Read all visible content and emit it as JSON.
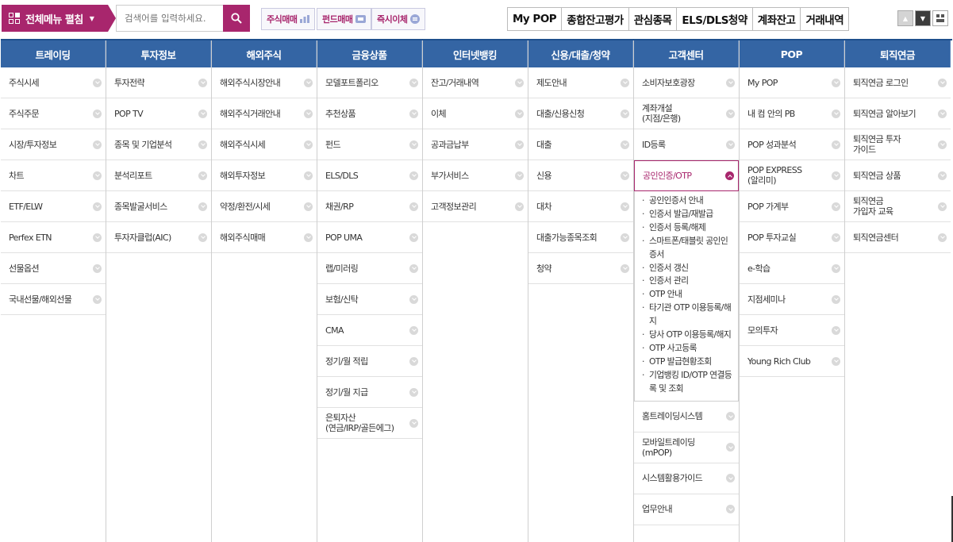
{
  "topbar": {
    "menu_label": "전체메뉴 펼침",
    "search_placeholder": "검색어를 입력하세요.",
    "quick": [
      {
        "label": "주식매매",
        "icon": "bar-chart-icon"
      },
      {
        "label": "펀드매매",
        "icon": "fund-icon"
      },
      {
        "label": "즉시이체",
        "icon": "transfer-icon"
      }
    ],
    "tabs": [
      "My POP",
      "종합잔고평가",
      "관심종목",
      "ELS/DLS청약",
      "계좌잔고",
      "거래내역"
    ]
  },
  "columns": [
    {
      "header": "트레이딩",
      "items": [
        "주식시세",
        "주식주문",
        "시장/투자정보",
        "차트",
        "ETF/ELW",
        "Perfex ETN",
        "선물옵션",
        "국내선물/해외선물"
      ]
    },
    {
      "header": "투자정보",
      "items": [
        "투자전략",
        "POP TV",
        "종목 및 기업분석",
        "분석리포트",
        "종목발굴서비스",
        "투자자클럽(AIC)"
      ]
    },
    {
      "header": "해외주식",
      "items": [
        "해외주식시장안내",
        "해외주식거래안내",
        "해외주식시세",
        "해외투자정보",
        "약정/환전/시세",
        "해외주식매매"
      ]
    },
    {
      "header": "금융상품",
      "items": [
        "모델포트폴리오",
        "추천상품",
        "펀드",
        "ELS/DLS",
        "채권/RP",
        "POP UMA",
        "랩/미러링",
        "보험/신탁",
        "CMA",
        "정기/월 적립",
        "정기/월 지급",
        "은퇴자산\n(연금/IRP/골든에그)"
      ]
    },
    {
      "header": "인터넷뱅킹",
      "items": [
        "잔고/거래내역",
        "이체",
        "공과금납부",
        "부가서비스",
        "고객정보관리"
      ]
    },
    {
      "header": "신용/대출/청약",
      "items": [
        "제도안내",
        "대출/신용신청",
        "대출",
        "신용",
        "대차",
        "대출가능종목조회",
        "청약"
      ]
    },
    {
      "header": "고객센터",
      "items_top": [
        "소비자보호광장",
        "계좌개설\n(지점/은행)",
        "ID등록"
      ],
      "selected": "공인인증/OTP",
      "sub_items": [
        "공인인증서 안내",
        "인증서 발급/재발급",
        "인증서 등록/해제",
        "스마트폰/태블릿 공인인증서",
        "인증서 갱신",
        "인증서 관리",
        "OTP 안내",
        "타기관 OTP 이용등록/해지",
        "당사 OTP 이용등록/해지",
        "OTP 사고등록",
        "OTP 발급현황조회",
        "기업뱅킹 ID/OTP 연결등록 및 조회"
      ],
      "items_bottom": [
        "홈트레이딩시스템",
        "모바일트레이딩\n(mPOP)",
        "시스템활용가이드",
        "업무안내"
      ]
    },
    {
      "header": "POP",
      "items": [
        "My POP",
        "내 컴 안의 PB",
        "POP 성과분석",
        "POP EXPRESS\n(알리미)",
        "POP 가계부",
        "POP 투자교실",
        "e-학습",
        "지점세미나",
        "모의투자",
        "Young Rich Club"
      ]
    },
    {
      "header": "퇴직연금",
      "items": [
        "퇴직연금 로그인",
        "퇴직연금 알아보기",
        "퇴직연금 투자\n가이드",
        "퇴직연금 상품",
        "퇴직연금\n가입자 교육",
        "퇴직연금센터"
      ]
    }
  ]
}
